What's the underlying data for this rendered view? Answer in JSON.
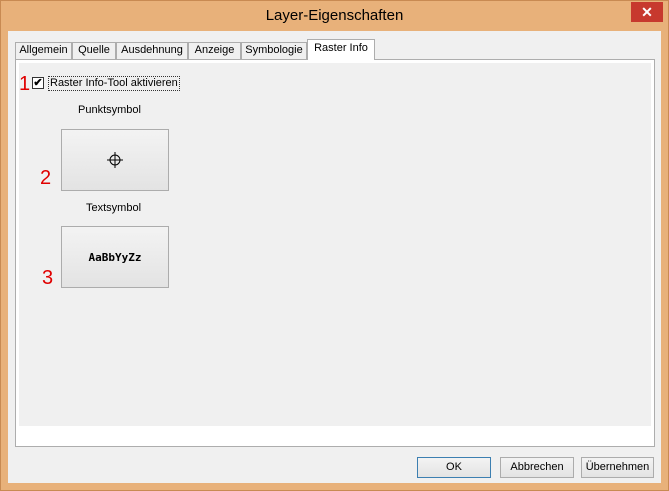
{
  "window": {
    "title": "Layer-Eigenschaften",
    "close_label": "✕"
  },
  "tabs": [
    {
      "label": "Allgemein",
      "active": false
    },
    {
      "label": "Quelle",
      "active": false
    },
    {
      "label": "Ausdehnung",
      "active": false
    },
    {
      "label": "Anzeige",
      "active": false
    },
    {
      "label": "Symbologie",
      "active": false
    },
    {
      "label": "Raster Info",
      "active": true
    }
  ],
  "raster_info": {
    "enable_checkbox": {
      "label": "Raster Info-Tool aktivieren",
      "checked": true,
      "mark": "✔"
    },
    "point_symbol_label": "Punktsymbol",
    "text_symbol_label": "Textsymbol",
    "text_symbol_sample": "AaBbYyZz"
  },
  "annotations": [
    "1",
    "2",
    "3"
  ],
  "buttons": {
    "ok": "OK",
    "cancel": "Abbrechen",
    "apply": "Übernehmen"
  },
  "colors": {
    "frame": "#e8b17a",
    "close": "#c7392e",
    "annotation": "#e00000"
  }
}
